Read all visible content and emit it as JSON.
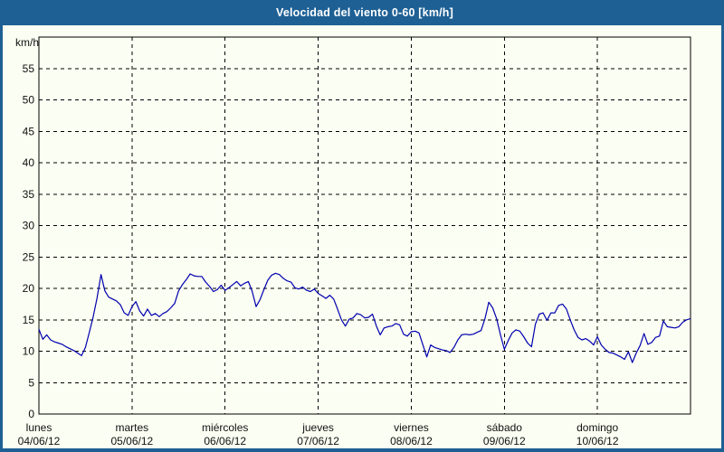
{
  "window": {
    "title": "Velocidad del viento 0-60 [km/h]"
  },
  "colors": {
    "titlebar_blue": "#1e6094",
    "frame_blue": "#1e6094",
    "content_background": "#fbfef2",
    "line_navy": "#0000b0",
    "grid_black": "#000000"
  },
  "chart_data": {
    "type": "line",
    "title": "Velocidad del viento 0-60 [km/h]",
    "xlabel": "",
    "ylabel": "km/h",
    "ylim": [
      0,
      60
    ],
    "y_ticks": [
      0,
      5,
      10,
      15,
      20,
      25,
      30,
      35,
      40,
      45,
      50,
      55
    ],
    "grid": true,
    "legend": "none",
    "days": [
      {
        "name": "lunes",
        "date": "04/06/12"
      },
      {
        "name": "martes",
        "date": "05/06/12"
      },
      {
        "name": "miércoles",
        "date": "06/06/12"
      },
      {
        "name": "jueves",
        "date": "07/06/12"
      },
      {
        "name": "viernes",
        "date": "08/06/12"
      },
      {
        "name": "sábado",
        "date": "09/06/12"
      },
      {
        "name": "domingo",
        "date": "10/06/12"
      }
    ],
    "points_per_day": 24,
    "series": [
      {
        "name": "Velocidad del viento (km/h)",
        "values": [
          13.5,
          11.9,
          12.6,
          11.8,
          11.5,
          11.3,
          11.1,
          10.7,
          10.4,
          10.1,
          9.7,
          9.3,
          10.6,
          13.0,
          15.5,
          18.5,
          22.2,
          19.6,
          18.6,
          18.3,
          18.0,
          17.4,
          16.1,
          15.7,
          17.1,
          17.9,
          16.4,
          15.6,
          16.7,
          15.7,
          16.0,
          15.5,
          16.0,
          16.3,
          16.9,
          17.6,
          19.6,
          20.6,
          21.4,
          22.3,
          22.0,
          21.9,
          21.9,
          21.0,
          20.3,
          19.5,
          19.8,
          20.5,
          19.7,
          20.1,
          20.6,
          21.1,
          20.4,
          20.8,
          21.1,
          19.5,
          17.1,
          18.2,
          19.8,
          21.3,
          22.1,
          22.4,
          22.2,
          21.6,
          21.2,
          21.0,
          20.1,
          19.9,
          20.2,
          19.7,
          19.5,
          19.9,
          19.2,
          18.8,
          18.4,
          18.9,
          18.3,
          16.7,
          15.0,
          14.0,
          15.1,
          15.3,
          16.0,
          15.8,
          15.3,
          15.4,
          15.9,
          14.0,
          12.6,
          13.7,
          13.9,
          14.0,
          14.4,
          14.2,
          12.7,
          12.4,
          13.1,
          13.2,
          12.9,
          11.0,
          9.1,
          11.0,
          10.6,
          10.4,
          10.2,
          10.1,
          9.8,
          10.6,
          11.8,
          12.6,
          12.7,
          12.6,
          12.7,
          13.0,
          13.3,
          15.2,
          17.8,
          16.9,
          15.2,
          12.6,
          10.3,
          11.7,
          12.9,
          13.4,
          13.2,
          12.3,
          11.3,
          10.7,
          14.3,
          15.9,
          16.1,
          14.9,
          16.1,
          16.1,
          17.3,
          17.5,
          16.7,
          15.0,
          13.4,
          12.2,
          11.8,
          12.0,
          11.6,
          11.0,
          12.3,
          11.0,
          10.3,
          9.8,
          9.7,
          9.4,
          9.1,
          8.7,
          9.9,
          8.2,
          9.7,
          10.9,
          12.8,
          11.1,
          11.4,
          12.2,
          12.4,
          14.8,
          13.9,
          13.8,
          13.7,
          13.9,
          14.6,
          15.0,
          15.2
        ]
      }
    ]
  }
}
